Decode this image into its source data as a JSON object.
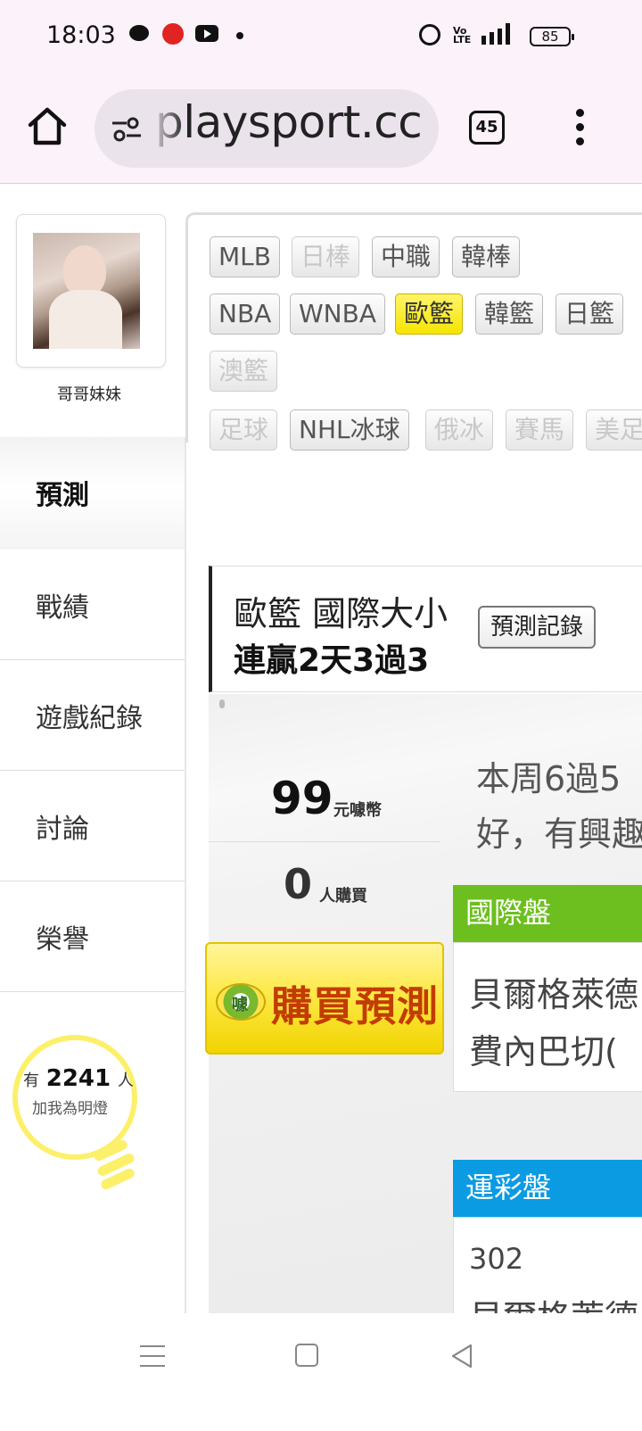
{
  "status_bar": {
    "time": "18:03",
    "volte": "Vo LTE",
    "network": "4G",
    "battery": "85",
    "icons": [
      "chat-icon",
      "app-notification-icon",
      "youtube-icon",
      "more-dot-icon",
      "alarm-icon",
      "signal-icon",
      "battery-icon"
    ]
  },
  "browser": {
    "url": "playsport.cc",
    "tab_count": "45"
  },
  "profile": {
    "nickname": "哥哥妹妹"
  },
  "sports_tags": [
    {
      "label": "MLB",
      "state": "normal"
    },
    {
      "label": "日棒",
      "state": "disabled"
    },
    {
      "label": "中職",
      "state": "normal"
    },
    {
      "label": "韓棒",
      "state": "normal"
    },
    {
      "label": "NBA",
      "state": "normal"
    },
    {
      "label": "WNBA",
      "state": "normal"
    },
    {
      "label": "歐籃",
      "state": "active"
    },
    {
      "label": "韓籃",
      "state": "normal"
    },
    {
      "label": "日籃",
      "state": "normal"
    },
    {
      "label": "澳籃",
      "state": "disabled"
    },
    {
      "label": "足球",
      "state": "disabled"
    },
    {
      "label": "NHL冰球",
      "state": "normal"
    },
    {
      "label": "俄冰",
      "state": "disabled"
    },
    {
      "label": "賽馬",
      "state": "disabled"
    },
    {
      "label": "美足",
      "state": "disabled"
    }
  ],
  "left_nav": {
    "active": "預測",
    "items": [
      "戰績",
      "遊戲紀錄",
      "討論",
      "榮譽"
    ]
  },
  "fans": {
    "prefix": "有",
    "count": "2241",
    "suffix": "人",
    "caption": "加我為明燈"
  },
  "prediction": {
    "title": "歐籃 國際大小",
    "streak": "連贏2天3過3",
    "record_button": "預測記錄",
    "price": "99",
    "price_unit": "元噱幣",
    "buyers": "0",
    "buyers_unit": "人購買",
    "buy_button": "購買預測",
    "coin_label": "噱",
    "description_line1": "本周6過5",
    "description_line2": "好，有興趣",
    "international": {
      "header": "國際盤",
      "line1": "貝爾格萊德",
      "line2": "費內巴切("
    },
    "lottery": {
      "header": "運彩盤",
      "line1": "302",
      "line2": "貝爾格萊德"
    }
  },
  "colors": {
    "status_bg": "#fcf2fa",
    "active_tag": "#f6e500",
    "international_header": "#6dbf1f",
    "lottery_header": "#0b9be3",
    "buy_text": "#c23c00",
    "bulb": "#fcf06a"
  }
}
